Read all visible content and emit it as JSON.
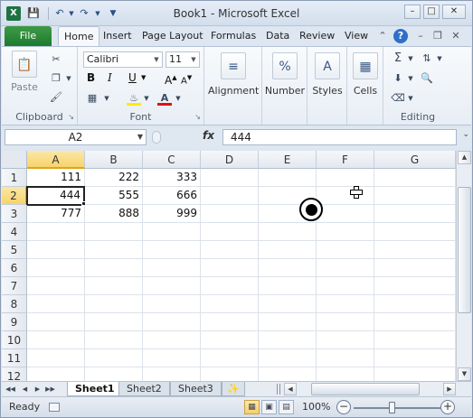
{
  "window": {
    "title": "Book1 - Microsoft Excel",
    "app_icon": "excel-logo-icon",
    "app_icon_letter": "X"
  },
  "quick_access": {
    "save": "save-icon",
    "undo": "undo-icon",
    "redo": "redo-icon",
    "customize": "customize-qa-icon"
  },
  "tabs": [
    {
      "label": "File"
    },
    {
      "label": "Home"
    },
    {
      "label": "Insert"
    },
    {
      "label": "Page Layout"
    },
    {
      "label": "Formulas"
    },
    {
      "label": "Data"
    },
    {
      "label": "Review"
    },
    {
      "label": "View"
    }
  ],
  "ribbon": {
    "clipboard": {
      "label": "Clipboard",
      "paste": "Paste"
    },
    "font": {
      "label": "Font",
      "name": "Calibri",
      "size": "11"
    },
    "alignment": {
      "label": "Alignment"
    },
    "number": {
      "label": "Number"
    },
    "styles": {
      "label": "Styles"
    },
    "cells": {
      "label": "Cells"
    },
    "editing": {
      "label": "Editing"
    }
  },
  "formula_bar": {
    "name_box": "A2",
    "fx": "fx",
    "value": "444"
  },
  "columns": [
    "A",
    "B",
    "C",
    "D",
    "E",
    "F",
    "G"
  ],
  "selected_column": "A",
  "rows": [
    "1",
    "2",
    "3",
    "4",
    "5",
    "6",
    "7",
    "8",
    "9",
    "10",
    "11",
    "12"
  ],
  "selected_row": "2",
  "cells": {
    "A1": "111",
    "B1": "222",
    "C1": "333",
    "A2": "444",
    "B2": "555",
    "C2": "666",
    "A3": "777",
    "B3": "888",
    "C3": "999"
  },
  "active_cell": "A2",
  "sheets": [
    {
      "label": "Sheet1",
      "active": true
    },
    {
      "label": "Sheet2",
      "active": false
    },
    {
      "label": "Sheet3",
      "active": false
    }
  ],
  "status": {
    "text": "Ready",
    "zoom": "100%",
    "zoom_level": 1.0
  },
  "colors": {
    "file_tab": "#2a8a37",
    "selection_header": "#f7d36b",
    "accent": "#2b579a"
  }
}
